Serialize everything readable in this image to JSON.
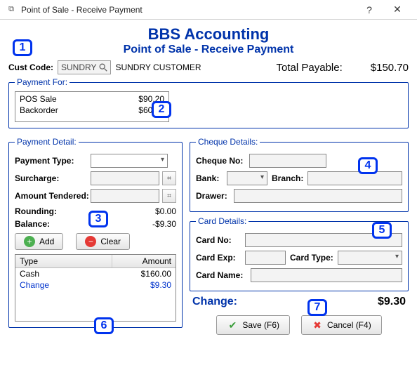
{
  "window": {
    "title": "Point of Sale - Receive Payment"
  },
  "headings": {
    "app": "BBS Accounting",
    "sub": "Point of Sale - Receive Payment"
  },
  "customer": {
    "label": "Cust Code:",
    "code": "SUNDRY",
    "name": "SUNDRY CUSTOMER"
  },
  "total": {
    "label": "Total Payable:",
    "value": "$150.70"
  },
  "payment_for": {
    "legend": "Payment For:",
    "rows": [
      {
        "label": "POS Sale",
        "amount": "$90.20"
      },
      {
        "label": "Backorder",
        "amount": "$60.50"
      }
    ]
  },
  "payment_detail": {
    "legend": "Payment Detail:",
    "payment_type_label": "Payment Type:",
    "surcharge_label": "Surcharge:",
    "amount_tendered_label": "Amount Tendered:",
    "rounding_label": "Rounding:",
    "rounding_value": "$0.00",
    "balance_label": "Balance:",
    "balance_value": "-$9.30",
    "add_label": "Add",
    "clear_label": "Clear",
    "grid": {
      "col_type": "Type",
      "col_amount": "Amount",
      "rows": [
        {
          "type": "Cash",
          "amount": "$160.00",
          "link": false
        },
        {
          "type": "Change",
          "amount": "$9.30",
          "link": true
        }
      ]
    }
  },
  "cheque": {
    "legend": "Cheque Details:",
    "no_label": "Cheque No:",
    "bank_label": "Bank:",
    "branch_label": "Branch:",
    "drawer_label": "Drawer:"
  },
  "card": {
    "legend": "Card Details:",
    "no_label": "Card No:",
    "exp_label": "Card Exp:",
    "type_label": "Card Type:",
    "name_label": "Card Name:"
  },
  "change": {
    "label": "Change:",
    "value": "$9.30"
  },
  "actions": {
    "save": "Save (F6)",
    "cancel": "Cancel (F4)"
  },
  "callouts": {
    "c1": "1",
    "c2": "2",
    "c3": "3",
    "c4": "4",
    "c5": "5",
    "c6": "6",
    "c7": "7"
  }
}
